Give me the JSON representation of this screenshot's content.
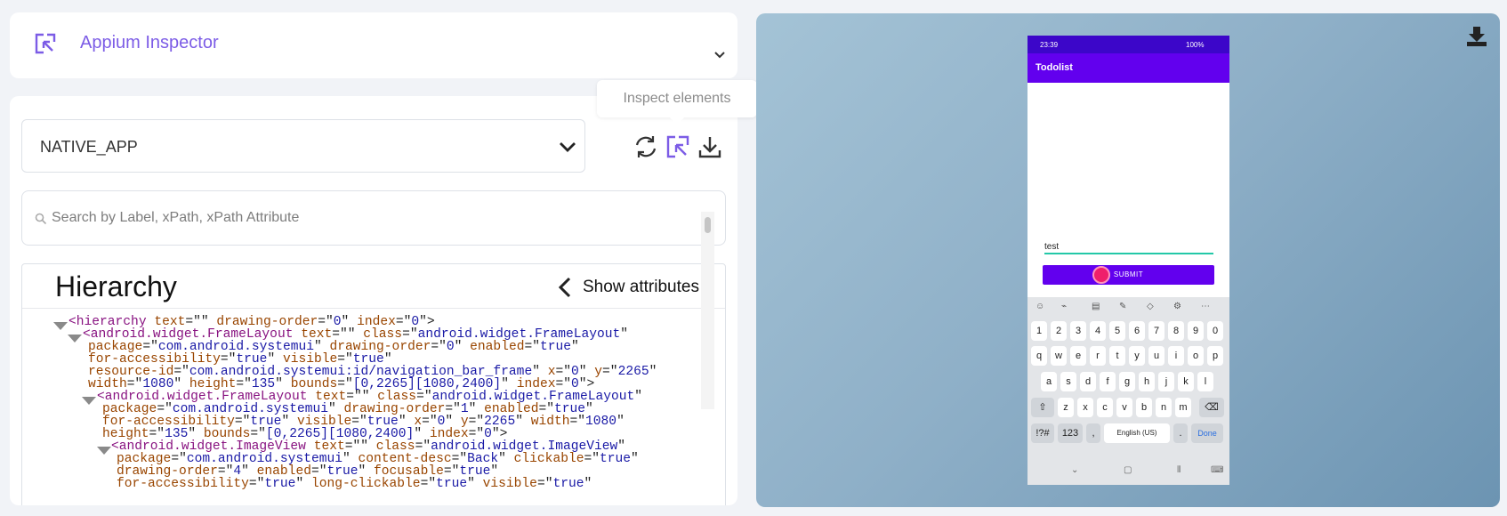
{
  "header": {
    "title": "Appium Inspector"
  },
  "context": {
    "selected": "NATIVE_APP"
  },
  "tooltip": {
    "text": "Inspect elements"
  },
  "search": {
    "placeholder": "Search by Label, xPath, xPath Attribute"
  },
  "hierarchy": {
    "title": "Hierarchy",
    "show_attributes_label": "Show attributes",
    "lines": [
      [
        [
          "t",
          "<hierarchy "
        ],
        [
          "a",
          "text"
        ],
        [
          "p",
          "=\""
        ],
        [
          "p",
          "\" "
        ],
        [
          "a",
          "drawing-order"
        ],
        [
          "p",
          "=\""
        ],
        [
          "v",
          "0"
        ],
        [
          "p",
          "\" "
        ],
        [
          "a",
          "index"
        ],
        [
          "p",
          "=\""
        ],
        [
          "v",
          "0"
        ],
        [
          "p",
          "\">"
        ]
      ],
      [
        [
          "t",
          "<android.widget.FrameLayout "
        ],
        [
          "a",
          "text"
        ],
        [
          "p",
          "=\"\" "
        ],
        [
          "a",
          "class"
        ],
        [
          "p",
          "=\""
        ],
        [
          "v",
          "android.widget.FrameLayout"
        ],
        [
          "p",
          "\""
        ]
      ],
      [
        [
          "a",
          "package"
        ],
        [
          "p",
          "=\""
        ],
        [
          "v",
          "com.android.systemui"
        ],
        [
          "p",
          "\" "
        ],
        [
          "a",
          "drawing-order"
        ],
        [
          "p",
          "=\""
        ],
        [
          "v",
          "0"
        ],
        [
          "p",
          "\" "
        ],
        [
          "a",
          "enabled"
        ],
        [
          "p",
          "=\""
        ],
        [
          "v",
          "true"
        ],
        [
          "p",
          "\""
        ]
      ],
      [
        [
          "a",
          "for-accessibility"
        ],
        [
          "p",
          "=\""
        ],
        [
          "v",
          "true"
        ],
        [
          "p",
          "\" "
        ],
        [
          "a",
          "visible"
        ],
        [
          "p",
          "=\""
        ],
        [
          "v",
          "true"
        ],
        [
          "p",
          "\""
        ]
      ],
      [
        [
          "a",
          "resource-id"
        ],
        [
          "p",
          "=\""
        ],
        [
          "v",
          "com.android.systemui:id/navigation_bar_frame"
        ],
        [
          "p",
          "\" "
        ],
        [
          "a",
          "x"
        ],
        [
          "p",
          "=\""
        ],
        [
          "v",
          "0"
        ],
        [
          "p",
          "\" "
        ],
        [
          "a",
          "y"
        ],
        [
          "p",
          "=\""
        ],
        [
          "v",
          "2265"
        ],
        [
          "p",
          "\""
        ]
      ],
      [
        [
          "a",
          "width"
        ],
        [
          "p",
          "=\""
        ],
        [
          "v",
          "1080"
        ],
        [
          "p",
          "\" "
        ],
        [
          "a",
          "height"
        ],
        [
          "p",
          "=\""
        ],
        [
          "v",
          "135"
        ],
        [
          "p",
          "\" "
        ],
        [
          "a",
          "bounds"
        ],
        [
          "p",
          "=\""
        ],
        [
          "v",
          "[0,2265][1080,2400]"
        ],
        [
          "p",
          "\" "
        ],
        [
          "a",
          "index"
        ],
        [
          "p",
          "=\""
        ],
        [
          "v",
          "0"
        ],
        [
          "p",
          "\">"
        ]
      ],
      [
        [
          "t",
          "<android.widget.FrameLayout "
        ],
        [
          "a",
          "text"
        ],
        [
          "p",
          "=\"\" "
        ],
        [
          "a",
          "class"
        ],
        [
          "p",
          "=\""
        ],
        [
          "v",
          "android.widget.FrameLayout"
        ],
        [
          "p",
          "\""
        ]
      ],
      [
        [
          "a",
          "package"
        ],
        [
          "p",
          "=\""
        ],
        [
          "v",
          "com.android.systemui"
        ],
        [
          "p",
          "\" "
        ],
        [
          "a",
          "drawing-order"
        ],
        [
          "p",
          "=\""
        ],
        [
          "v",
          "1"
        ],
        [
          "p",
          "\" "
        ],
        [
          "a",
          "enabled"
        ],
        [
          "p",
          "=\""
        ],
        [
          "v",
          "true"
        ],
        [
          "p",
          "\""
        ]
      ],
      [
        [
          "a",
          "for-accessibility"
        ],
        [
          "p",
          "=\""
        ],
        [
          "v",
          "true"
        ],
        [
          "p",
          "\" "
        ],
        [
          "a",
          "visible"
        ],
        [
          "p",
          "=\""
        ],
        [
          "v",
          "true"
        ],
        [
          "p",
          "\" "
        ],
        [
          "a",
          "x"
        ],
        [
          "p",
          "=\""
        ],
        [
          "v",
          "0"
        ],
        [
          "p",
          "\" "
        ],
        [
          "a",
          "y"
        ],
        [
          "p",
          "=\""
        ],
        [
          "v",
          "2265"
        ],
        [
          "p",
          "\" "
        ],
        [
          "a",
          "width"
        ],
        [
          "p",
          "=\""
        ],
        [
          "v",
          "1080"
        ],
        [
          "p",
          "\""
        ]
      ],
      [
        [
          "a",
          "height"
        ],
        [
          "p",
          "=\""
        ],
        [
          "v",
          "135"
        ],
        [
          "p",
          "\" "
        ],
        [
          "a",
          "bounds"
        ],
        [
          "p",
          "=\""
        ],
        [
          "v",
          "[0,2265][1080,2400]"
        ],
        [
          "p",
          "\" "
        ],
        [
          "a",
          "index"
        ],
        [
          "p",
          "=\""
        ],
        [
          "v",
          "0"
        ],
        [
          "p",
          "\">"
        ]
      ],
      [
        [
          "t",
          "<android.widget.ImageView "
        ],
        [
          "a",
          "text"
        ],
        [
          "p",
          "=\"\" "
        ],
        [
          "a",
          "class"
        ],
        [
          "p",
          "=\""
        ],
        [
          "v",
          "android.widget.ImageView"
        ],
        [
          "p",
          "\""
        ]
      ],
      [
        [
          "a",
          "package"
        ],
        [
          "p",
          "=\""
        ],
        [
          "v",
          "com.android.systemui"
        ],
        [
          "p",
          "\" "
        ],
        [
          "a",
          "content-desc"
        ],
        [
          "p",
          "=\""
        ],
        [
          "v",
          "Back"
        ],
        [
          "p",
          "\" "
        ],
        [
          "a",
          "clickable"
        ],
        [
          "p",
          "=\""
        ],
        [
          "v",
          "true"
        ],
        [
          "p",
          "\""
        ]
      ],
      [
        [
          "a",
          "drawing-order"
        ],
        [
          "p",
          "=\""
        ],
        [
          "v",
          "4"
        ],
        [
          "p",
          "\" "
        ],
        [
          "a",
          "enabled"
        ],
        [
          "p",
          "=\""
        ],
        [
          "v",
          "true"
        ],
        [
          "p",
          "\" "
        ],
        [
          "a",
          "focusable"
        ],
        [
          "p",
          "=\""
        ],
        [
          "v",
          "true"
        ],
        [
          "p",
          "\""
        ]
      ],
      [
        [
          "a",
          "for-accessibility"
        ],
        [
          "p",
          "=\""
        ],
        [
          "v",
          "true"
        ],
        [
          "p",
          "\" "
        ],
        [
          "a",
          "long-clickable"
        ],
        [
          "p",
          "=\""
        ],
        [
          "v",
          "true"
        ],
        [
          "p",
          "\" "
        ],
        [
          "a",
          "visible"
        ],
        [
          "p",
          "=\""
        ],
        [
          "v",
          "true"
        ],
        [
          "p",
          "\""
        ]
      ]
    ]
  },
  "device": {
    "status_time": "23:39",
    "status_battery": "100%",
    "app_title": "Todolist",
    "input_value": "test",
    "submit_label": "SUBMIT",
    "keyboard": {
      "number_row": [
        "1",
        "2",
        "3",
        "4",
        "5",
        "6",
        "7",
        "8",
        "9",
        "0"
      ],
      "row1": [
        "q",
        "w",
        "e",
        "r",
        "t",
        "y",
        "u",
        "i",
        "o",
        "p"
      ],
      "row2": [
        "a",
        "s",
        "d",
        "f",
        "g",
        "h",
        "j",
        "k",
        "l"
      ],
      "row3": [
        "z",
        "x",
        "c",
        "v",
        "b",
        "n",
        "m"
      ],
      "symbols_key": "!?#",
      "numbers_key": "123",
      "comma_key": ",",
      "space_label": "English (US)",
      "period_key": ".",
      "done_key": "Done"
    }
  },
  "colors": {
    "accent": "#7c5ce6",
    "app_bar": "#6200ee",
    "status_bar": "#3c06c9",
    "tap_indicator": "#ef1f6b"
  }
}
